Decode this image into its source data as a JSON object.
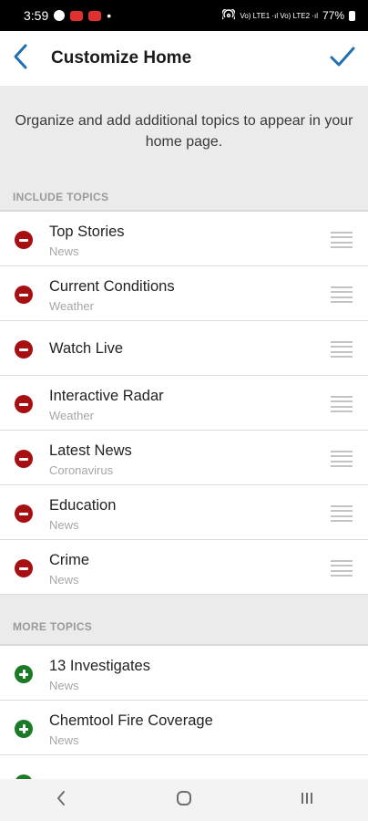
{
  "status_bar": {
    "time": "3:59",
    "dot": "•",
    "network_text": "Vo) LTE1 ·ıl Vo) LTE2 ·ıl",
    "battery": "77%"
  },
  "header": {
    "title": "Customize Home",
    "back_icon": "chevron-left-icon",
    "confirm_icon": "checkmark-icon"
  },
  "intro": "Organize and add additional topics to appear in your home page.",
  "include_section": {
    "label": "INCLUDE TOPICS",
    "items": [
      {
        "title": "Top Stories",
        "subtitle": "News"
      },
      {
        "title": "Current Conditions",
        "subtitle": "Weather"
      },
      {
        "title": "Watch Live",
        "subtitle": ""
      },
      {
        "title": "Interactive Radar",
        "subtitle": "Weather"
      },
      {
        "title": "Latest News",
        "subtitle": "Coronavirus"
      },
      {
        "title": "Education",
        "subtitle": "News"
      },
      {
        "title": "Crime",
        "subtitle": "News"
      }
    ]
  },
  "more_section": {
    "label": "MORE TOPICS",
    "items": [
      {
        "title": "13 Investigates",
        "subtitle": "News"
      },
      {
        "title": "Chemtool Fire Coverage",
        "subtitle": "News"
      }
    ]
  },
  "colors": {
    "accent": "#1f6fb2",
    "remove": "#a80f12",
    "add": "#1a7a26"
  },
  "nav_bar": {
    "back_icon": "nav-back-icon",
    "home_icon": "nav-home-icon",
    "recents_icon": "nav-recents-icon"
  }
}
